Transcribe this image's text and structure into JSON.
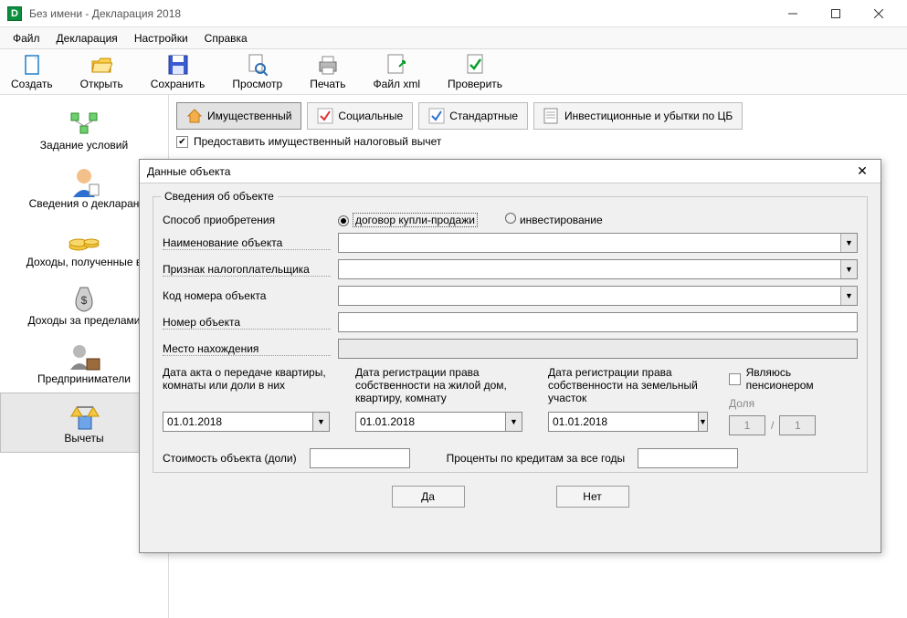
{
  "window": {
    "title": "Без имени - Декларация 2018"
  },
  "menu": [
    "Файл",
    "Декларация",
    "Настройки",
    "Справка"
  ],
  "toolbar": [
    {
      "label": "Создать",
      "icon": "new"
    },
    {
      "label": "Открыть",
      "icon": "open"
    },
    {
      "label": "Сохранить",
      "icon": "save"
    },
    {
      "label": "Просмотр",
      "icon": "preview"
    },
    {
      "label": "Печать",
      "icon": "print"
    },
    {
      "label": "Файл xml",
      "icon": "xml"
    },
    {
      "label": "Проверить",
      "icon": "check"
    }
  ],
  "sidebar": [
    "Задание условий",
    "Сведения о декларан",
    "Доходы, полученные в",
    "Доходы за пределами",
    "Предприниматели",
    "Вычеты"
  ],
  "tabs": {
    "property": "Имущественный",
    "social": "Социальные",
    "standard": "Стандартные",
    "invest": "Инвестиционные и убытки по ЦБ"
  },
  "checkbox": {
    "provide": "Предоставить имущественный налоговый вычет"
  },
  "dialog": {
    "title": "Данные объекта",
    "group": "Сведения об объекте",
    "method_label": "Способ приобретения",
    "radio_contract": "договор купли-продажи",
    "radio_invest": "инвестирование",
    "object_name": "Наименование объекта",
    "taxpayer_attr": "Признак налогоплательщика",
    "code_number": "Код номера объекта",
    "object_number": "Номер объекта",
    "location": "Место нахождения",
    "date_act": "Дата акта о передаче квартиры, комнаты или доли в них",
    "date_reg_house": "Дата регистрации права собственности на жилой дом, квартиру, комнату",
    "date_reg_land": "Дата регистрации права собственности на земельный участок",
    "pensioner": "Являюсь пенсионером",
    "share": "Доля",
    "share_num": "1",
    "share_den": "1",
    "date_default": "01.01.2018",
    "cost_label": "Стоимость объекта (доли)",
    "credit_label": "Проценты по кредитам за все годы",
    "yes": "Да",
    "no": "Нет"
  }
}
